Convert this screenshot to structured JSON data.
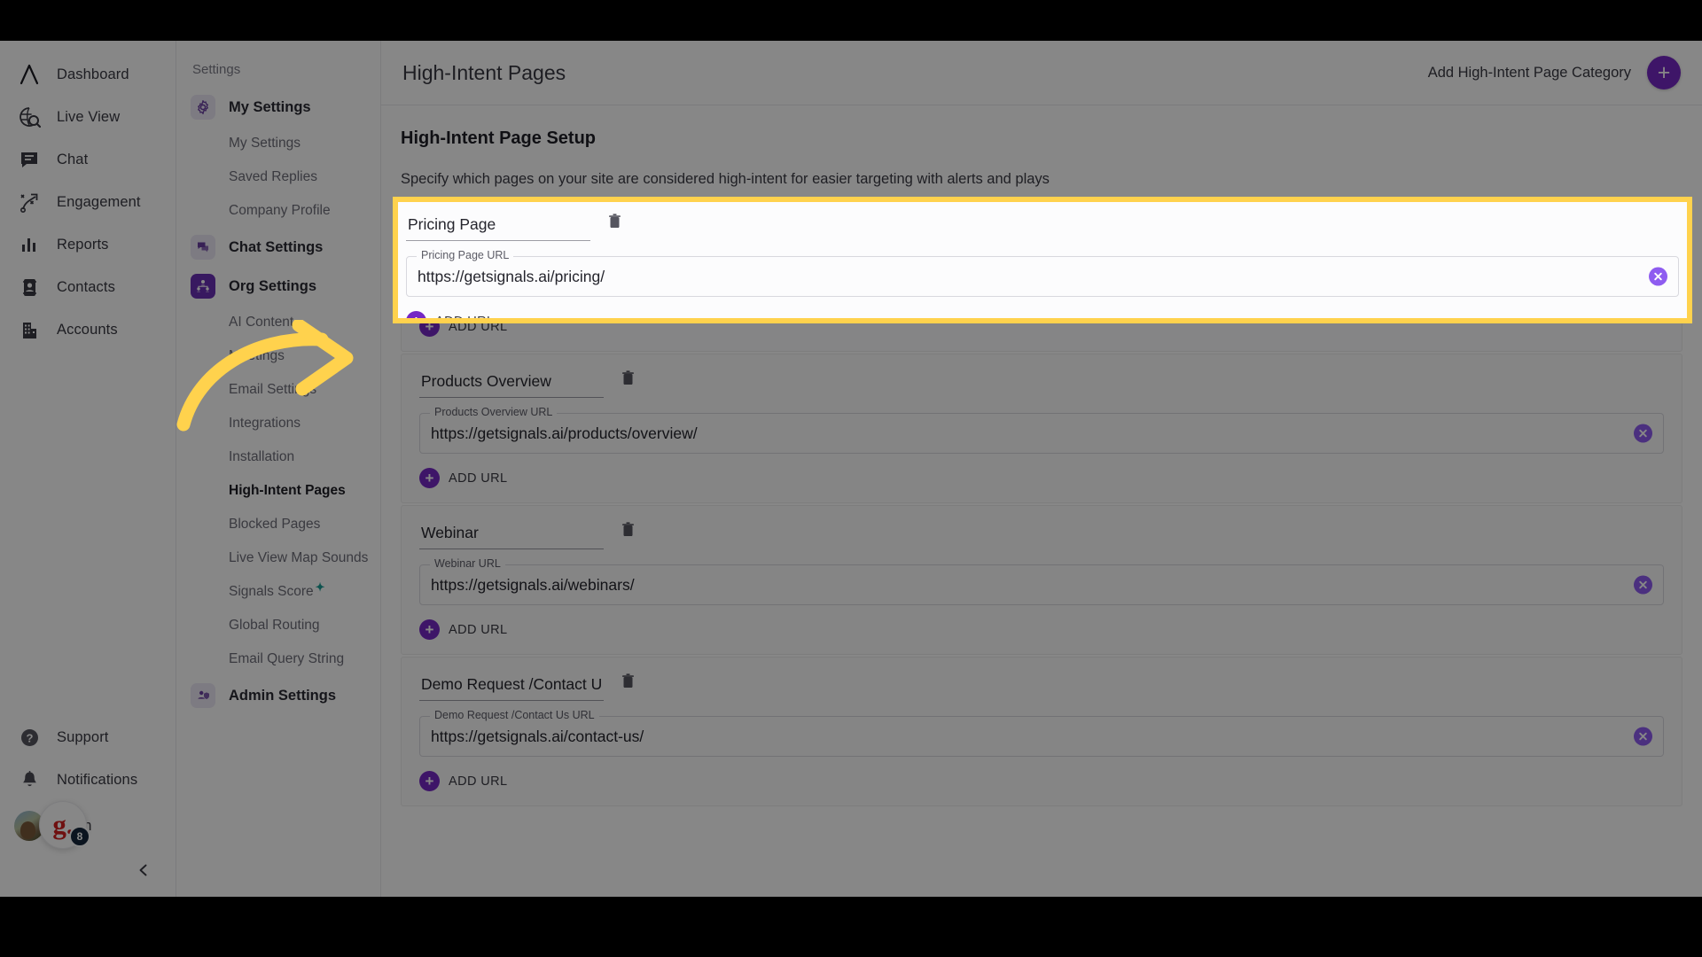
{
  "main_nav": {
    "items": [
      {
        "label": "Dashboard",
        "icon": "logo-a-icon"
      },
      {
        "label": "Live View",
        "icon": "globe-search-icon"
      },
      {
        "label": "Chat",
        "icon": "chat-bubble-icon"
      },
      {
        "label": "Engagement",
        "icon": "engagement-play-icon"
      },
      {
        "label": "Reports",
        "icon": "bar-chart-icon"
      },
      {
        "label": "Contacts",
        "icon": "contact-card-icon"
      },
      {
        "label": "Accounts",
        "icon": "building-icon"
      }
    ],
    "bottom_items": [
      {
        "label": "Support",
        "icon": "question-circle-icon"
      },
      {
        "label": "Notifications",
        "icon": "bell-icon"
      }
    ],
    "user": {
      "name": "Ngan",
      "badge_letter": "g.",
      "badge_count": "8"
    },
    "collapse_icon": "chevron-left-icon"
  },
  "settings_nav": {
    "title": "Settings",
    "groups": [
      {
        "label": "My Settings",
        "icon": "gear-icon",
        "active": false,
        "items": [
          {
            "label": "My Settings",
            "selected": false
          },
          {
            "label": "Saved Replies",
            "selected": false
          },
          {
            "label": "Company Profile",
            "selected": false
          }
        ]
      },
      {
        "label": "Chat Settings",
        "icon": "chat-settings-icon",
        "active": false,
        "items": []
      },
      {
        "label": "Org Settings",
        "icon": "org-chart-icon",
        "active": true,
        "items": [
          {
            "label": "AI Content",
            "selected": false
          },
          {
            "label": "Meetings",
            "selected": false
          },
          {
            "label": "Email Settings",
            "selected": false
          },
          {
            "label": "Integrations",
            "selected": false
          },
          {
            "label": "Installation",
            "selected": false
          },
          {
            "label": "High-Intent Pages",
            "selected": true
          },
          {
            "label": "Blocked Pages",
            "selected": false
          },
          {
            "label": "Live View Map Sounds",
            "selected": false
          },
          {
            "label": "Signals Score",
            "selected": false,
            "sparkle": "✦"
          },
          {
            "label": "Global Routing",
            "selected": false
          },
          {
            "label": "Email Query String",
            "selected": false
          }
        ]
      },
      {
        "label": "Admin Settings",
        "icon": "admin-shield-icon",
        "active": false,
        "items": []
      }
    ]
  },
  "header": {
    "title": "High-Intent Pages",
    "add_category_label": "Add High-Intent Page Category",
    "add_category_icon": "plus-icon"
  },
  "panel": {
    "title": "High-Intent Page Setup",
    "subtitle": "Specify which pages on your site are considered high-intent for easier targeting with alerts and plays"
  },
  "add_url_label": "ADD URL",
  "icons": {
    "trash": "trash-icon",
    "clear": "clear-circle-icon",
    "plus": "plus-circle-icon"
  },
  "cards": [
    {
      "name": "Pricing Page",
      "url_legend": "Pricing Page URL",
      "url": "https://getsignals.ai/pricing/",
      "highlighted": true
    },
    {
      "name": "Products Overview",
      "url_legend": "Products Overview URL",
      "url": "https://getsignals.ai/products/overview/",
      "highlighted": false
    },
    {
      "name": "Webinar",
      "url_legend": "Webinar URL",
      "url": "https://getsignals.ai/webinars/",
      "highlighted": false
    },
    {
      "name": "Demo Request /Contact Us",
      "url_legend": "Demo Request /Contact Us URL",
      "url": "https://getsignals.ai/contact-us/",
      "highlighted": false
    }
  ],
  "annotation": {
    "arrow_color": "#ffd24d",
    "highlight_color": "#ffd24d"
  }
}
